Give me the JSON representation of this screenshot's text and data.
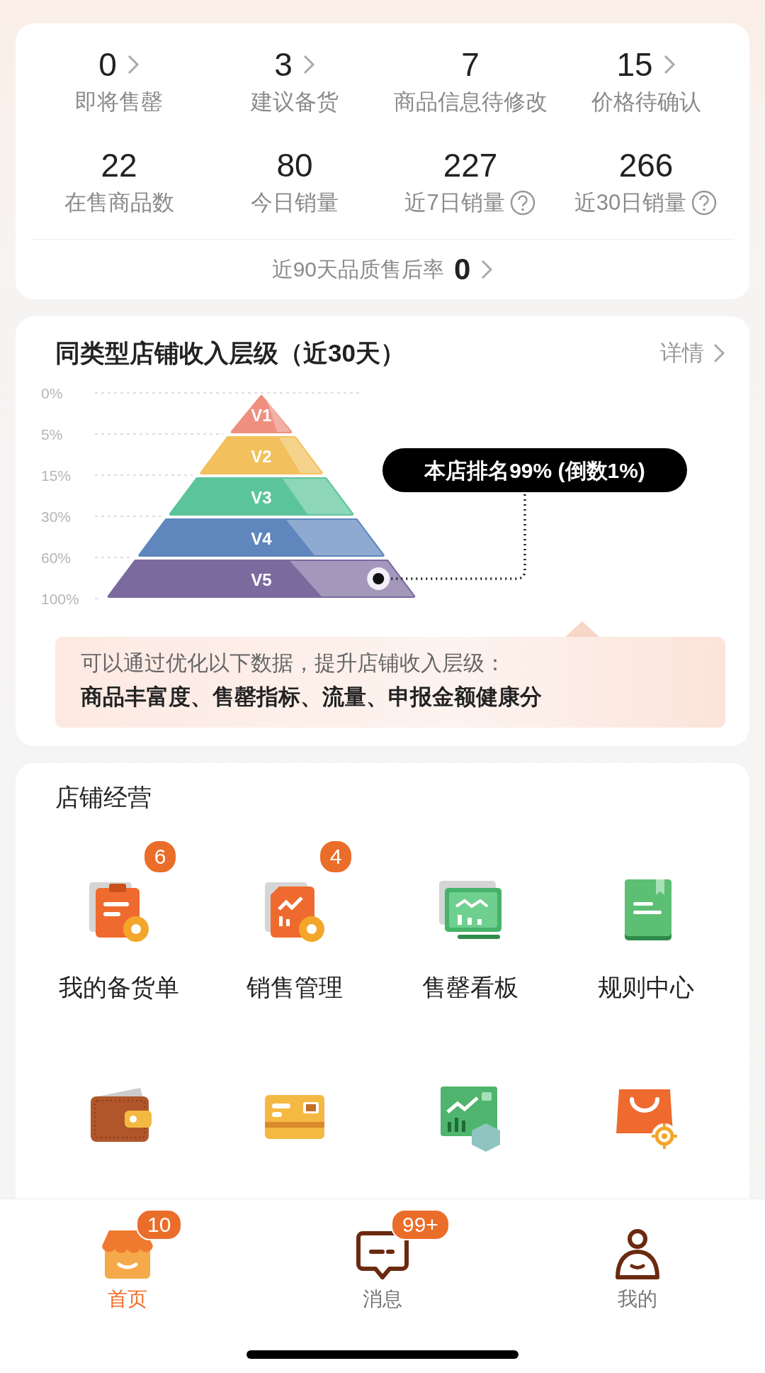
{
  "summary": {
    "top_stats": [
      {
        "value": "0",
        "label": "即将售罄",
        "arrow": true,
        "help": false
      },
      {
        "value": "3",
        "label": "建议备货",
        "arrow": true,
        "help": false
      },
      {
        "value": "7",
        "label": "商品信息待修改",
        "arrow": false,
        "help": false
      },
      {
        "value": "15",
        "label": "价格待确认",
        "arrow": true,
        "help": false
      }
    ],
    "sales_stats": [
      {
        "value": "22",
        "label": "在售商品数",
        "arrow": false,
        "help": false
      },
      {
        "value": "80",
        "label": "今日销量",
        "arrow": false,
        "help": false
      },
      {
        "value": "227",
        "label": "近7日销量",
        "arrow": false,
        "help": true
      },
      {
        "value": "266",
        "label": "近30日销量",
        "arrow": false,
        "help": true
      }
    ],
    "quality": {
      "label": "近90天品质售后率",
      "value": "0",
      "arrow": true
    }
  },
  "tier": {
    "title": "同类型店铺收入层级（近30天）",
    "details_link": "详情",
    "ticks": [
      "0%",
      "5%",
      "15%",
      "30%",
      "60%",
      "100%"
    ],
    "levels": [
      {
        "label": "V1",
        "color": "#ee8f7f",
        "selected": false
      },
      {
        "label": "V2",
        "color": "#f2c05c",
        "selected": false
      },
      {
        "label": "V3",
        "color": "#5cc49a",
        "selected": false
      },
      {
        "label": "V4",
        "color": "#5f86bd",
        "selected": false
      },
      {
        "label": "V5",
        "color": "#7b6a9e",
        "selected": true
      }
    ],
    "rank_tooltip": "本店排名99% (倒数1%)",
    "tip_line": "可以通过优化以下数据，提升店铺收入层级：",
    "tip_metrics": "商品丰富度、售罄指标、流量、申报金额健康分"
  },
  "operations": {
    "title": "店铺经营",
    "tools": [
      {
        "kind": "stock",
        "label": "我的备货单",
        "badge": "6"
      },
      {
        "kind": "sales",
        "label": "销售管理",
        "badge": "4"
      },
      {
        "kind": "board",
        "label": "售罄看板"
      },
      {
        "kind": "rules",
        "label": "规则中心"
      },
      {
        "kind": "wallet"
      },
      {
        "kind": "card"
      },
      {
        "kind": "fulfill"
      },
      {
        "kind": "bag"
      }
    ]
  },
  "tab_bar": [
    {
      "kind": "home",
      "label": "首页",
      "badge": "10",
      "selected": true
    },
    {
      "kind": "message",
      "label": "消息",
      "badge": "99+",
      "selected": false
    },
    {
      "kind": "me",
      "label": "我的",
      "selected": false
    }
  ]
}
